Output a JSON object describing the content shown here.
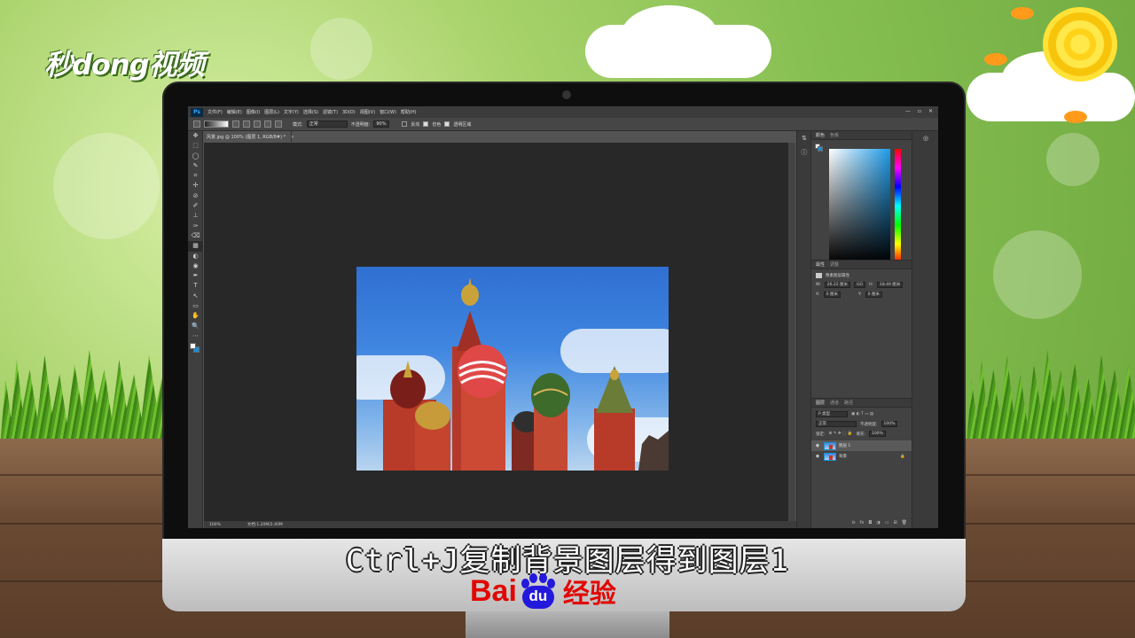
{
  "logo": "秒dong视频",
  "photoshop": {
    "ps_icon": "Ps",
    "menu": [
      "文件(F)",
      "编辑(E)",
      "图像(I)",
      "图层(L)",
      "文字(Y)",
      "选择(S)",
      "滤镜(T)",
      "3D(D)",
      "视图(V)",
      "窗口(W)",
      "帮助(H)"
    ],
    "window_controls": [
      "—",
      "▫",
      "✕"
    ],
    "options": {
      "mode_label": "模式:",
      "mode_value": "正常",
      "opacity_label": "不透明度:",
      "opacity_value": "90%",
      "reverse_label": "反向",
      "dither_label": "仿色",
      "transparency_label": "透明区域"
    },
    "tools": [
      "✥",
      "⬚",
      "◯",
      "✎",
      "⌗",
      "✢",
      "⊘",
      "✐",
      "⊥",
      "✑",
      "⌫",
      "▦",
      "◐",
      "◉",
      "✒",
      "T",
      "↖",
      "▭",
      "✋",
      "🔍",
      "⋯"
    ],
    "doc_tab": "风景.jpg @ 100% (图层 1, RGB/8#) *",
    "doc_tab_close": "×",
    "status_zoom": "100%",
    "status_doc": "文档:1.20M/2.40M",
    "color_panel": {
      "tab_active": "颜色",
      "tab_inactive": "色板"
    },
    "properties_panel": {
      "tab_active": "属性",
      "tab_inactive": "调整",
      "title": "像素图层属性",
      "w_label": "W:",
      "w_value": "26.22 厘米",
      "link": "GO",
      "h_label": "H:",
      "h_value": "18.49 厘米",
      "x_label": "X:",
      "x_value": "0 厘米",
      "y_label": "Y:",
      "y_value": "0 厘米"
    },
    "layers_panel": {
      "tabs": [
        "图层",
        "通道",
        "路径"
      ],
      "filter": "P 类型",
      "blend_mode": "正常",
      "opacity_label": "不透明度:",
      "opacity_value": "100%",
      "lock_label": "锁定:",
      "fill_label": "填充:",
      "fill_value": "100%",
      "layers": [
        {
          "name": "图层 1",
          "selected": true
        },
        {
          "name": "背景",
          "selected": false,
          "locked": true
        }
      ],
      "bottom_icons": [
        "⊖",
        "fx",
        "◘",
        "◑",
        "▭",
        "⊞",
        "🗑"
      ]
    }
  },
  "subtitle": "Ctrl+J复制背景图层得到图层1",
  "baidu": {
    "left": "Bai",
    "paw": "du",
    "right": "经验"
  },
  "colors": {
    "ps_bg": "#535353",
    "canvas": "#282828",
    "accent": "#1a8fd6",
    "baidu_red": "#e10602",
    "baidu_blue": "#2319dc"
  }
}
